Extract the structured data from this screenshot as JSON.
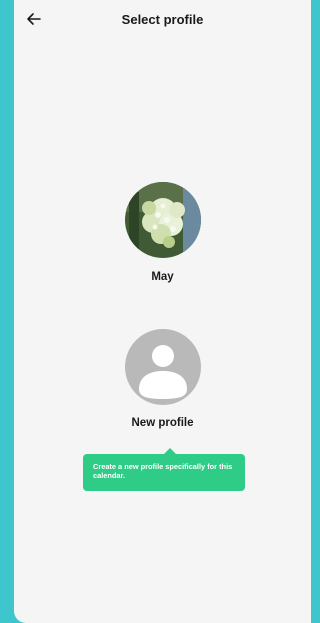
{
  "header": {
    "title": "Select profile",
    "back_icon": "arrow-left-icon"
  },
  "profiles": [
    {
      "name": "May",
      "avatar": "flower-photo"
    },
    {
      "name": "New profile",
      "avatar": "person-placeholder-icon"
    }
  ],
  "tooltip": {
    "text": "Create a new profile specifically for this calendar."
  },
  "colors": {
    "frame": "#3ec6cc",
    "background": "#f5f5f5",
    "tooltip": "#2ecc86",
    "placeholder_avatar": "#b9b9b9"
  }
}
